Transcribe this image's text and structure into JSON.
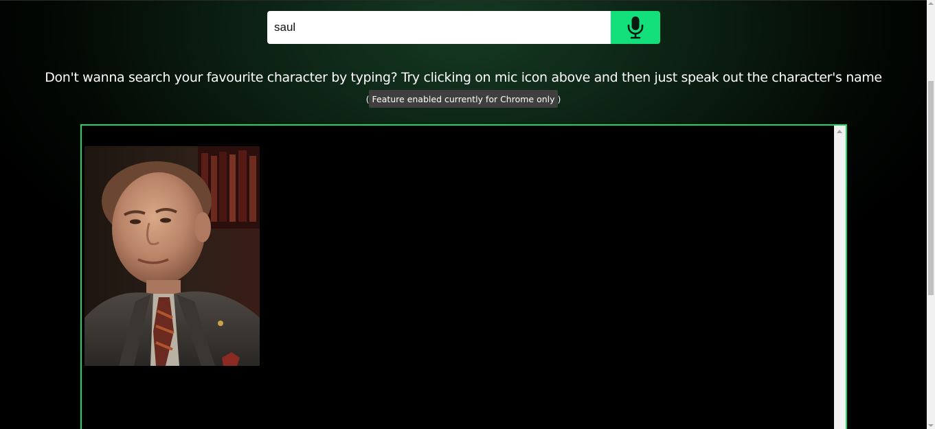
{
  "search": {
    "value": "saul",
    "placeholder": ""
  },
  "mic_button": {
    "icon": "microphone-icon"
  },
  "hint": {
    "text": "Don't wanna search your favourite character by typing? Try clicking on mic icon above and then just speak out the character's name"
  },
  "note": {
    "text": "( Feature enabled currently for Chrome only )"
  },
  "results": {
    "items": [
      {
        "image": "character-portrait"
      }
    ]
  },
  "colors": {
    "accent": "#13e07a",
    "border": "#1ed760",
    "background": "#000000",
    "note_bg": "#3f3f3f"
  }
}
